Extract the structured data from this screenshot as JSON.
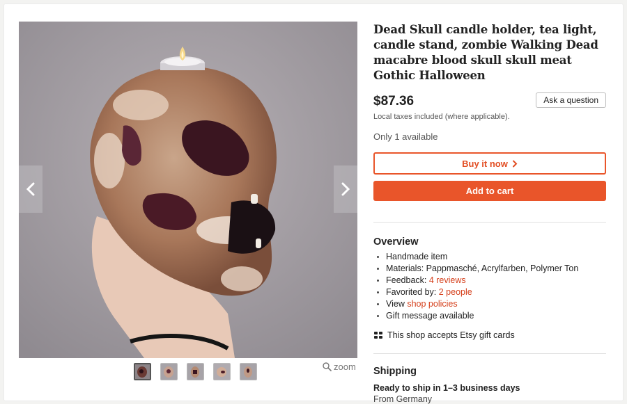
{
  "product": {
    "title": "Dead Skull candle holder, tea light, candle stand, zombie Walking Dead macabre blood skull skull meat Gothic Halloween",
    "price": "$87.36",
    "tax_note": "Local taxes included (where applicable).",
    "availability": "Only 1 available"
  },
  "actions": {
    "ask_question": "Ask a question",
    "buy_now": "Buy it now",
    "add_to_cart": "Add to cart"
  },
  "gallery": {
    "zoom_label": "zoom",
    "thumbnail_count": 5,
    "active_thumbnail": 1
  },
  "overview": {
    "heading": "Overview",
    "items": {
      "handmade": "Handmade item",
      "materials": "Materials: Pappmasché, Acrylfarben, Polymer Ton",
      "feedback_prefix": "Feedback: ",
      "feedback_link": "4 reviews",
      "favorited_prefix": "Favorited by: ",
      "favorited_link": "2 people",
      "view_prefix": "View ",
      "view_link": "shop policies",
      "gift_message": "Gift message available"
    },
    "gift_cards": "This shop accepts Etsy gift cards"
  },
  "shipping": {
    "heading": "Shipping",
    "ready": "Ready to ship in 1–3 business days",
    "from": "From Germany"
  },
  "colors": {
    "accent": "#e9552a",
    "link": "#d5401c"
  }
}
